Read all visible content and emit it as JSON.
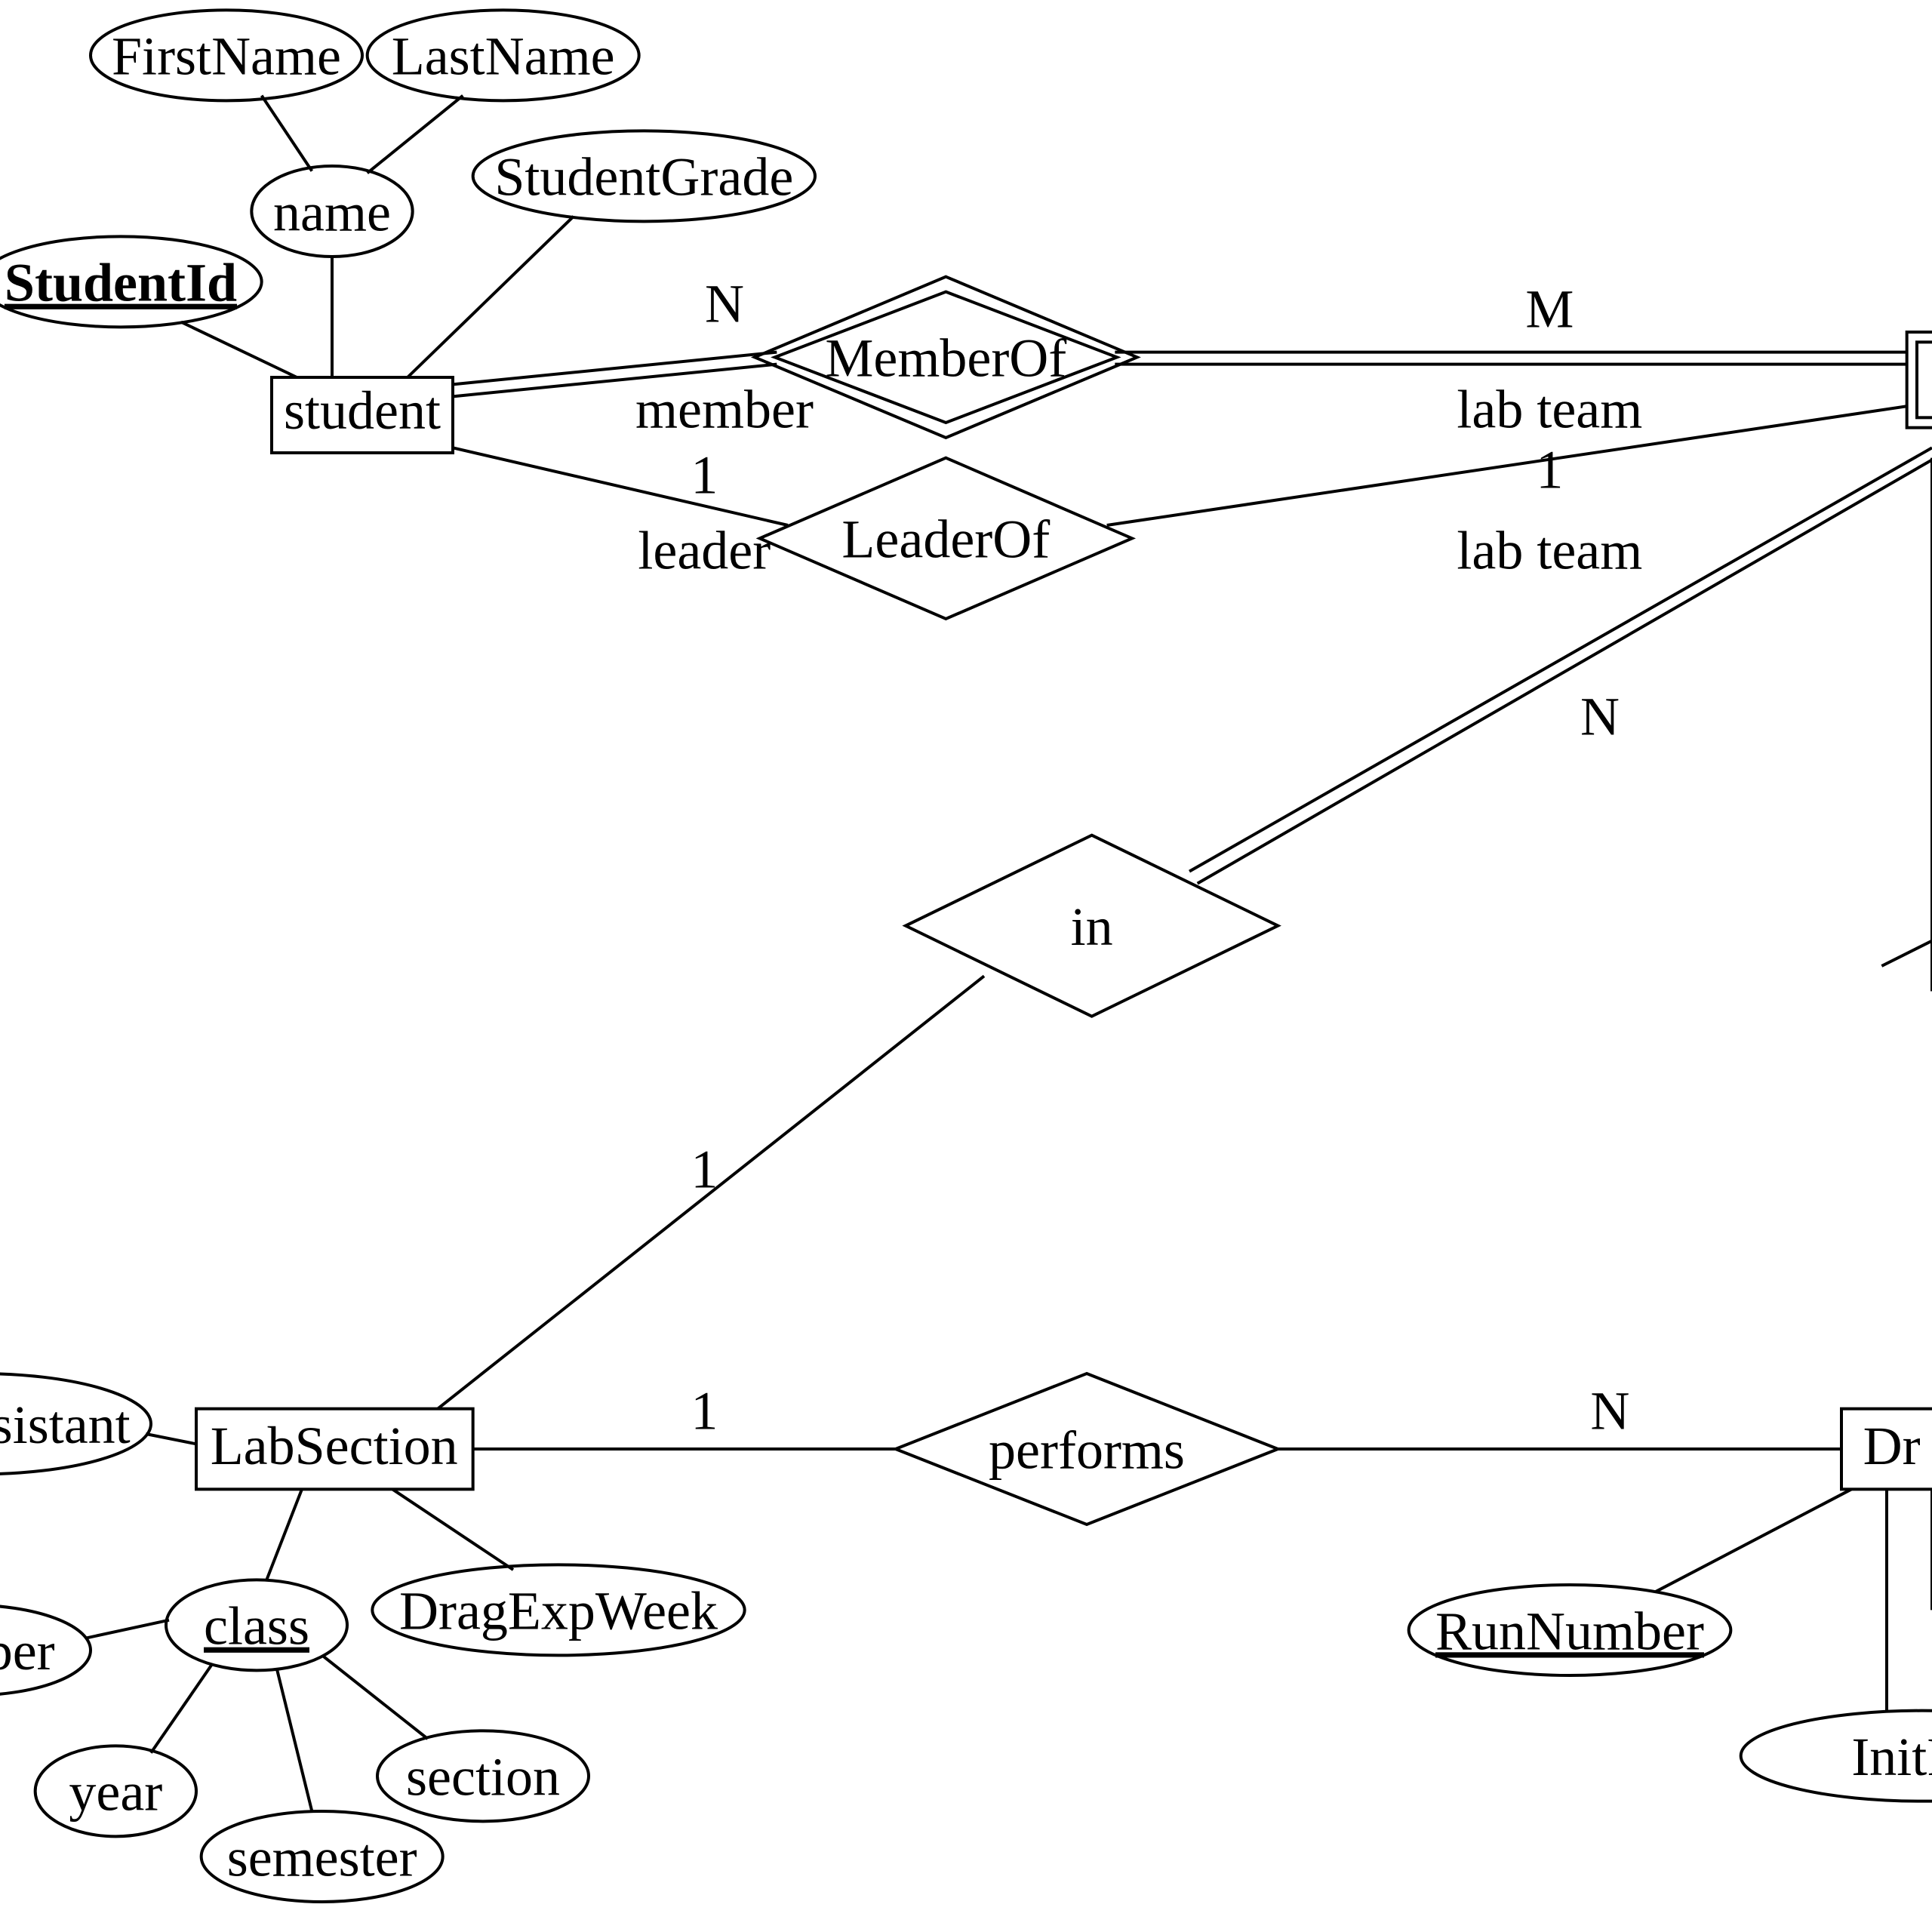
{
  "entities": {
    "student": "student",
    "labSection": "LabSection",
    "dragExp": "Dr"
  },
  "relationships": {
    "memberOf": "MemberOf",
    "leaderOf": "LeaderOf",
    "in": "in",
    "performs": "performs"
  },
  "attributes": {
    "firstName": "FirstName",
    "lastName": "LastName",
    "name": "name",
    "studentId": "StudentId",
    "studentGrade": "StudentGrade",
    "assistant": "ssistant",
    "class": "class",
    "number": "ber",
    "year": "year",
    "semester": "semester",
    "section": "section",
    "dragExpWeek": "DragExpWeek",
    "runNumber": "RunNumber",
    "initPosition": "InitPositi"
  },
  "roles": {
    "member": "member",
    "leader": "leader",
    "labTeam1": "lab team",
    "labTeam2": "lab team"
  },
  "cardinalities": {
    "memberOf_student": "N",
    "memberOf_team": "M",
    "leaderOf_student": "1",
    "leaderOf_team": "1",
    "in_team": "N",
    "in_section": "1",
    "performs_section": "1",
    "performs_exp": "N"
  }
}
